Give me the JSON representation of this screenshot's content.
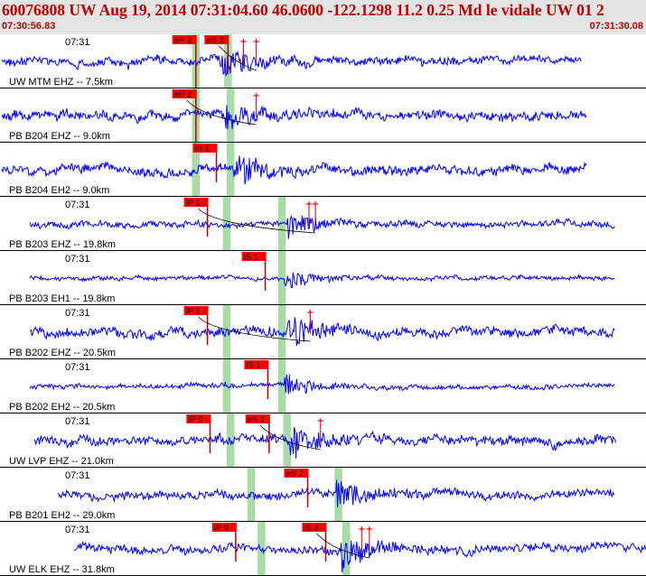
{
  "header": {
    "title": "60076808 UW Aug 19, 2014 07:31:04.60   46.0600 -122.1298 11.2 0.25 Md le vidale UW 01   2",
    "time_start": "07:30:56.83",
    "time_end": "07:31:30.08"
  },
  "colors": {
    "header_text": "#c00000",
    "trace": "#0000ff",
    "pick_box": "#ff0000",
    "pick_line": "#c00000",
    "window_band": "#a8dba8"
  },
  "traces": [
    {
      "time_label": "07:31",
      "label": "UW MTM EHZ -- 7.5km",
      "band_windows": [
        [
          7.4,
          7.7
        ],
        [
          8.65,
          8.95
        ]
      ],
      "wave_range": [
        0.0,
        22.55
      ],
      "arrival": 8.5,
      "noise": 0.16,
      "peak": 0.75,
      "picks": [
        {
          "label": "eP 2",
          "t": 7.55,
          "kind": "box",
          "bar_full": true
        },
        {
          "label": "eS 2",
          "t": 8.8,
          "kind": "box",
          "bar_full": false
        }
      ],
      "plus": [
        9.4,
        9.9
      ]
    },
    {
      "time_label": "",
      "label": "PB B204 EHZ -- 9.0km",
      "band_windows": [
        [
          7.4,
          7.7
        ],
        [
          8.75,
          9.05
        ]
      ],
      "wave_range": [
        0.0,
        22.75
      ],
      "arrival": 8.7,
      "noise": 0.18,
      "peak": 0.55,
      "picks": [
        {
          "label": "eP 2",
          "t": 7.55,
          "kind": "box",
          "bar_full": true
        }
      ],
      "plus": [
        9.9
      ]
    },
    {
      "time_label": "",
      "label": "PB B204 EH2 -- 9.0km",
      "band_windows": [
        [
          7.4,
          7.7
        ],
        [
          8.75,
          9.05
        ]
      ],
      "wave_range": [
        0.0,
        22.75
      ],
      "arrival": 9.0,
      "noise": 0.18,
      "peak": 0.7,
      "picks": [
        {
          "label": "iS 1",
          "t": 8.35,
          "kind": "box",
          "bar_full": false
        }
      ],
      "plus": []
    },
    {
      "time_label": "07:31",
      "label": "PB B203 EHZ -- 19.8km",
      "band_windows": [
        [
          8.6,
          8.9
        ],
        [
          10.75,
          11.05
        ]
      ],
      "wave_range": [
        1.1,
        23.85
      ],
      "arrival": 11.1,
      "noise": 0.12,
      "peak": 0.7,
      "picks": [
        {
          "label": "iP 1",
          "t": 8.0,
          "kind": "box",
          "bar_full": false
        }
      ],
      "plus": [
        11.95,
        12.2
      ]
    },
    {
      "time_label": "07:31",
      "label": "PB B203 EH1 -- 19.8km",
      "band_windows": [
        [
          10.75,
          11.05
        ]
      ],
      "wave_range": [
        1.1,
        23.85
      ],
      "arrival": 11.0,
      "noise": 0.08,
      "peak": 0.5,
      "picks": [
        {
          "label": "iS 1",
          "t": 10.25,
          "kind": "box",
          "bar_full": false
        }
      ],
      "plus": []
    },
    {
      "time_label": "07:31",
      "label": "PB B202 EHZ -- 20.5km",
      "band_windows": [
        [
          8.6,
          8.9
        ],
        [
          10.75,
          11.05
        ]
      ],
      "wave_range": [
        1.1,
        23.85
      ],
      "arrival": 11.1,
      "noise": 0.18,
      "peak": 0.75,
      "picks": [
        {
          "label": "iP 1",
          "t": 8.0,
          "kind": "box",
          "bar_full": false
        }
      ],
      "plus": [
        12.0
      ]
    },
    {
      "time_label": "07:31",
      "label": "PB B202 EH2 -- 20.5km",
      "band_windows": [
        [
          8.6,
          8.9
        ],
        [
          10.75,
          11.05
        ]
      ],
      "wave_range": [
        1.1,
        23.85
      ],
      "arrival": 11.0,
      "noise": 0.09,
      "peak": 0.5,
      "picks": [
        {
          "label": "iS 1",
          "t": 10.35,
          "kind": "box",
          "bar_full": false
        }
      ],
      "plus": []
    },
    {
      "time_label": "07:31",
      "label": "UW LVP EHZ -- 21.0km",
      "band_windows": [
        [
          8.75,
          9.05
        ],
        [
          10.95,
          11.25
        ]
      ],
      "wave_range": [
        1.25,
        23.9
      ],
      "arrival": 11.2,
      "noise": 0.18,
      "peak": 0.75,
      "picks": [
        {
          "label": "iP 0",
          "t": 8.1,
          "kind": "box",
          "bar_full": false
        },
        {
          "label": "eS 1",
          "t": 10.4,
          "kind": "box",
          "bar_full": false
        }
      ],
      "plus": [
        12.4
      ]
    },
    {
      "time_label": "07:31",
      "label": "PB B201 EH2 -- 29.0km",
      "band_windows": [
        [
          9.55,
          9.85
        ],
        [
          12.95,
          13.25
        ]
      ],
      "wave_range": [
        2.2,
        23.85
      ],
      "arrival": 13.0,
      "noise": 0.16,
      "peak": 0.75,
      "picks": [
        {
          "label": "eS 2",
          "t": 11.9,
          "kind": "box",
          "bar_full": false
        }
      ],
      "plus": []
    },
    {
      "time_label": "07:31",
      "label": "UW ELK EHZ -- 31.8km",
      "band_windows": [
        [
          9.95,
          10.25
        ],
        [
          13.25,
          13.55
        ]
      ],
      "wave_range": [
        2.8,
        25.05
      ],
      "arrival": 13.2,
      "noise": 0.16,
      "peak": 0.75,
      "picks": [
        {
          "label": "iP 0",
          "t": 9.1,
          "kind": "box",
          "bar_full": false
        },
        {
          "label": "iS 1",
          "t": 12.6,
          "kind": "box",
          "bar_full": false
        }
      ],
      "plus": [
        14.0,
        14.3
      ]
    }
  ]
}
